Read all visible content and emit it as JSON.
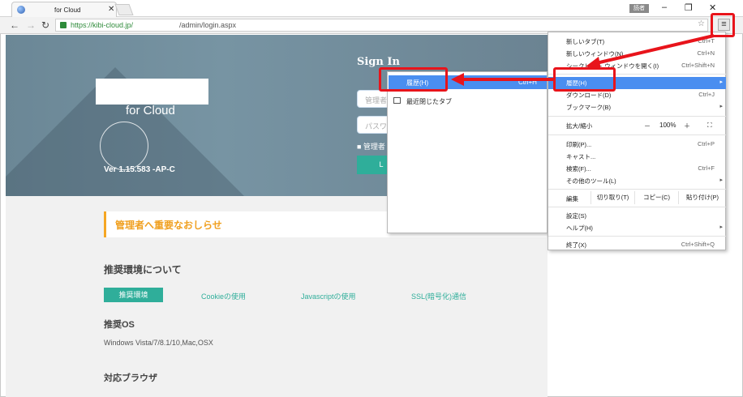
{
  "browser": {
    "tab_title": "for Cloud",
    "tab_close": "✕",
    "username_badge": "読者",
    "minimize": "–",
    "restore": "❐",
    "close": "✕",
    "url_secure": "https://kibi-cloud.jp/",
    "url_path": "/admin/login.aspx",
    "menu_icon": "≡",
    "star_icon": "☆"
  },
  "hero": {
    "logo_text": "for  Cloud",
    "version": "Ver 1.15.583 -AP-C",
    "signin_title": "Sign In",
    "admin_placeholder": "管理者",
    "password_placeholder": "パスワ",
    "remember_label": "■ 管理者",
    "login_button": "L"
  },
  "content": {
    "notice": "管理者へ重要なおしらせ",
    "env_heading": "推奨環境について",
    "tabs": [
      "推奨環境",
      "Cookieの使用",
      "Javascriptの使用",
      "SSL(暗号化)通信"
    ],
    "os_heading": "推奨OS",
    "os_text": "Windows Vista/7/8.1/10,Mac,OSX",
    "browser_heading": "対応ブラウザ"
  },
  "history_submenu": {
    "items": [
      {
        "label": "履歴(H)",
        "shortcut": "Ctrl+H"
      },
      {
        "label": "最近閉じたタブ",
        "shortcut": ""
      }
    ]
  },
  "main_menu": {
    "new_tab": {
      "label": "新しいタブ(T)",
      "shortcut": "Ctrl+T"
    },
    "new_window": {
      "label": "新しいウィンドウ(N)",
      "shortcut": "Ctrl+N"
    },
    "incognito": {
      "label": "シークレット ウィンドウを開く(I)",
      "shortcut": "Ctrl+Shift+N"
    },
    "history": {
      "label": "履歴(H)",
      "arrow": "▸"
    },
    "downloads": {
      "label": "ダウンロード(D)",
      "shortcut": "Ctrl+J"
    },
    "bookmarks": {
      "label": "ブックマーク(B)",
      "arrow": "▸"
    },
    "zoom": {
      "label": "拡大/縮小",
      "minus": "－",
      "value": "100%",
      "plus": "＋",
      "fullscreen": "⛶"
    },
    "print": {
      "label": "印刷(P)...",
      "shortcut": "Ctrl+P"
    },
    "cast": {
      "label": "キャスト..."
    },
    "find": {
      "label": "検索(F)...",
      "shortcut": "Ctrl+F"
    },
    "more_tools": {
      "label": "その他のツール(L)",
      "arrow": "▸"
    },
    "edit": {
      "label": "編集",
      "cut": "切り取り(T)",
      "copy": "コピー(C)",
      "paste": "貼り付け(P)"
    },
    "settings": {
      "label": "設定(S)"
    },
    "help": {
      "label": "ヘルプ(H)",
      "arrow": "▸"
    },
    "exit": {
      "label": "終了(X)",
      "shortcut": "Ctrl+Shift+Q"
    }
  },
  "colors": {
    "annotation": "#e8141b",
    "highlight": "#4a8ef0",
    "accent": "#2fae9a"
  }
}
